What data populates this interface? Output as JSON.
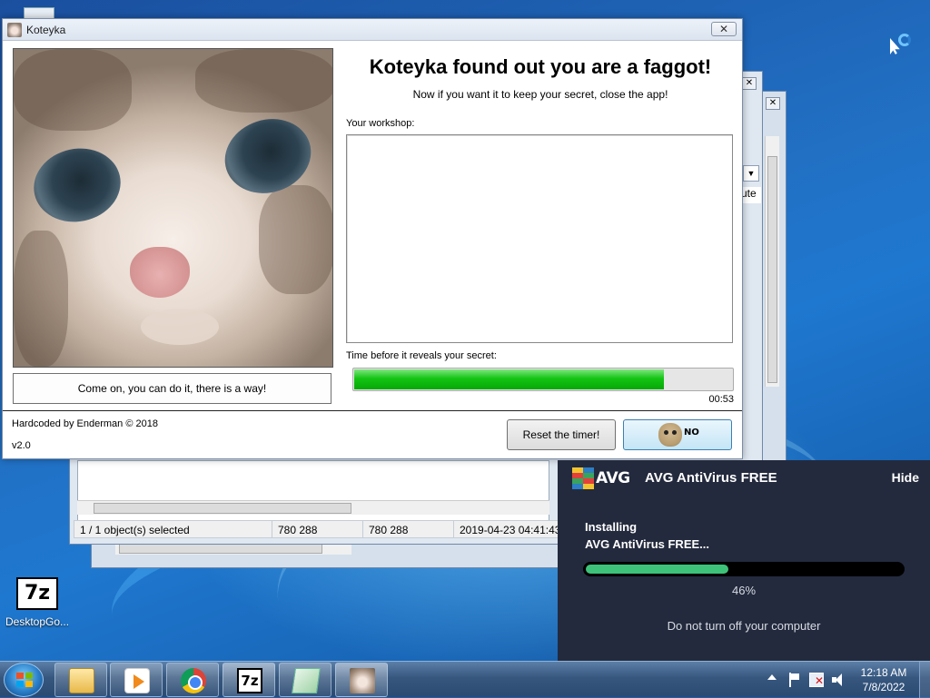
{
  "desktop": {
    "icon_label": "DesktopGo...",
    "icon_glyph": "7z"
  },
  "background_window": {
    "close_glyph": "✕",
    "column_tail": "ute",
    "combo_glyph": "▼",
    "status": {
      "selected": "1 / 1 object(s) selected",
      "size": "780 288",
      "packed": "780 288",
      "modified": "2019-04-23 04:41:43"
    }
  },
  "koteyka": {
    "title": "Koteyka",
    "close_glyph": "✕",
    "heading": "Koteyka found out you are a faggot!",
    "subheading": "Now if you want it to keep your secret, close the app!",
    "workshop_label": "Your workshop:",
    "workshop_text": "",
    "timer_label": "Time before it reveals your secret:",
    "timer_progress": 0.82,
    "timer_remaining": "00:53",
    "hint_button": "Come on, you can do it, there is a way!",
    "credit": "Hardcoded by Enderman © 2018",
    "version": "v2.0",
    "reset_button": "Reset the timer!",
    "face_button_text": "NO"
  },
  "avg": {
    "logo_text": "AVG",
    "product": "AVG AntiVirus FREE",
    "hide": "Hide",
    "installing": "Installing",
    "installing_product": "AVG AntiVirus FREE...",
    "progress": 0.46,
    "percent_text": "46%",
    "note": "Do not turn off your computer",
    "colors": {
      "background": "#232a3d",
      "progress": "#3ec27a"
    }
  },
  "taskbar": {
    "buttons": [
      "file-explorer",
      "media-player",
      "chrome",
      "7-zip",
      "notepad",
      "koteyka"
    ],
    "clock_time": "12:18 AM",
    "clock_date": "7/8/2022"
  }
}
